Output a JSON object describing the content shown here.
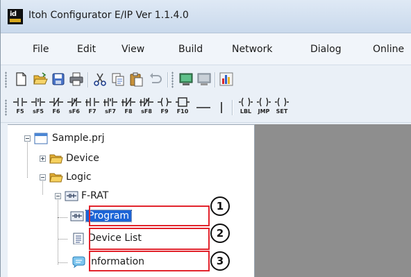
{
  "window": {
    "title": "Itoh Configurator E/IP Ver 1.1.4.0",
    "app_icon_text": "id"
  },
  "menu": {
    "items": [
      "File",
      "Edit",
      "View",
      "Build",
      "Network",
      "Dialog",
      "Online"
    ]
  },
  "toolbar_main": {
    "icons": [
      "new-file-icon",
      "open-folder-icon",
      "save-icon",
      "print-icon",
      "cut-icon",
      "copy-icon",
      "paste-icon",
      "undo-icon",
      "download-icon",
      "upload-icon",
      "monitor-icon"
    ]
  },
  "toolbar_ladder": {
    "keys": [
      "F5",
      "sF5",
      "F6",
      "sF6",
      "F7",
      "sF7",
      "F8",
      "sF8",
      "F9",
      "F10",
      "",
      "",
      "LBL",
      "JMP",
      "SET"
    ]
  },
  "tree": {
    "root": "Sample.prj",
    "device": "Device",
    "logic": "Logic",
    "frat": "F-RAT",
    "program": "Program",
    "device_list": "Device List",
    "information": "Information"
  },
  "callouts": {
    "one": "1",
    "two": "2",
    "three": "3"
  },
  "colors": {
    "callout_border": "#e2232c",
    "selection": "#1b63d6",
    "workspace": "#8e8e8e"
  }
}
